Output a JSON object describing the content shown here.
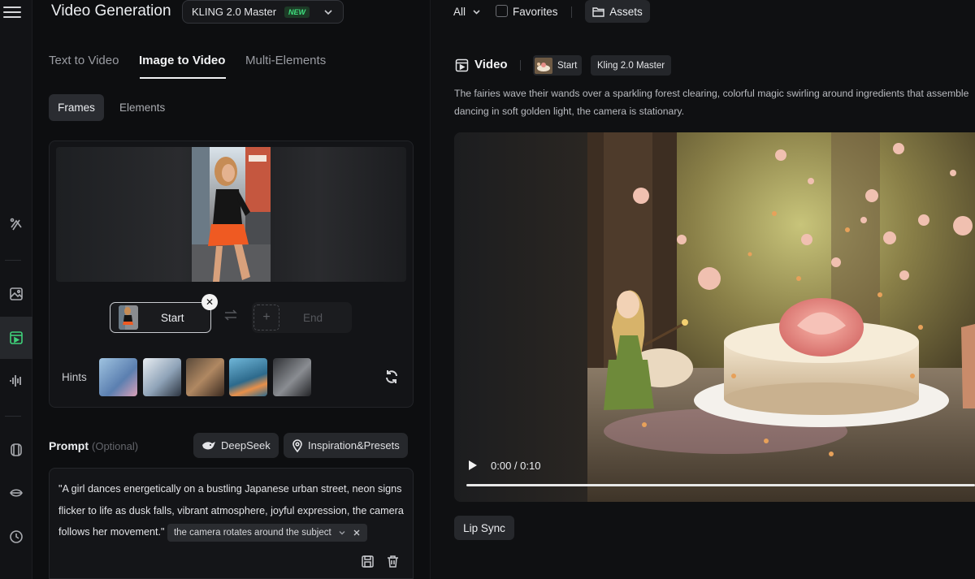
{
  "header": {
    "title": "Video Generation",
    "model": "KLING 2.0 Master",
    "model_badge": "NEW"
  },
  "tabs": [
    {
      "label": "Text to Video",
      "active": false
    },
    {
      "label": "Image to Video",
      "active": true
    },
    {
      "label": "Multi-Elements",
      "active": false
    }
  ],
  "segments": {
    "frames": "Frames",
    "elements": "Elements"
  },
  "frames": {
    "start_label": "Start",
    "end_label": "End",
    "hints_label": "Hints"
  },
  "prompt": {
    "label": "Prompt",
    "optional": "(Optional)",
    "deepseek": "DeepSeek",
    "presets": "Inspiration&Presets",
    "text": "\"A girl dances energetically on a bustling Japanese urban street, neon signs flicker to life as dusk falls, vibrant atmosphere, joyful expression, the camera follows her movement.\"",
    "suggestion": "the camera rotates around the subject"
  },
  "right": {
    "filter_all": "All",
    "favorites": "Favorites",
    "assets": "Assets",
    "video_title": "Video",
    "tag_start": "Start",
    "tag_model": "Kling 2.0 Master",
    "description_line1": "The fairies wave their wands over a sparkling forest clearing, colorful magic swirling around ingredients that assemble",
    "description_line2": "dancing in soft golden light, the camera is stationary.",
    "time": "0:00 / 0:10",
    "lip_sync": "Lip Sync"
  },
  "colors": {
    "accent_green": "#3fd17a",
    "badge_green": "#3fe07f",
    "background": "#0d0e10"
  },
  "icons": [
    "menu-icon",
    "chevron-down-icon",
    "effects-icon",
    "image-icon",
    "video-icon",
    "audio-icon",
    "avatar-icon",
    "lips-icon",
    "history-icon",
    "swap-icon",
    "plus-icon",
    "close-icon",
    "refresh-icon",
    "deepseek-icon",
    "location-pin-icon",
    "save-icon",
    "trash-icon",
    "folder-icon",
    "play-icon"
  ]
}
